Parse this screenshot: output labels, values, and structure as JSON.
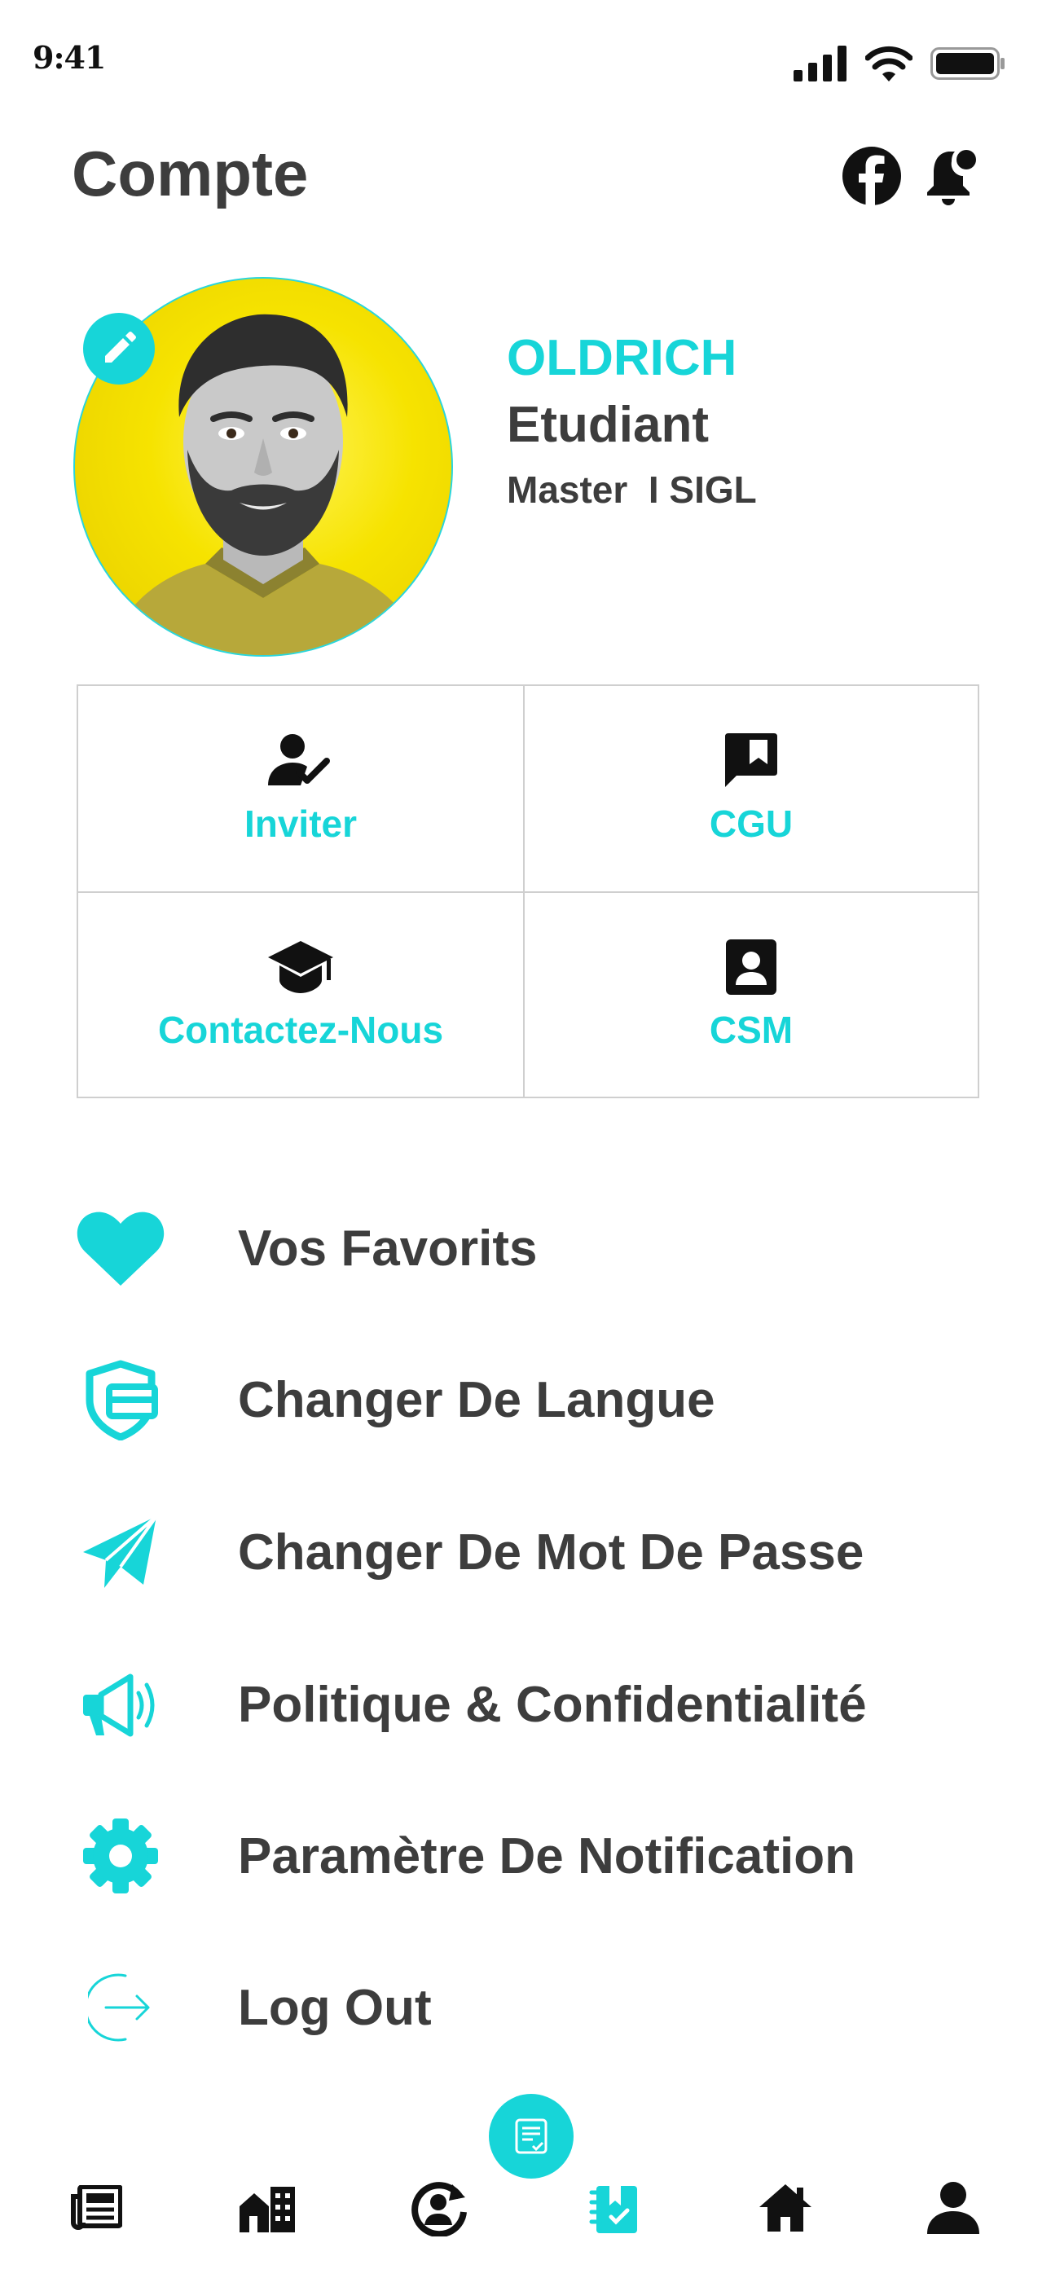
{
  "status_bar": {
    "time": "9:41"
  },
  "header": {
    "title": "Compte"
  },
  "profile": {
    "name": "OLDRICH",
    "role": "Etudiant",
    "level": "Master  I SIGL"
  },
  "grid": [
    {
      "label": "Inviter",
      "icon": "person-check-icon"
    },
    {
      "label": "CGU",
      "icon": "comment-bookmark-icon"
    },
    {
      "label": "Contactez-Nous",
      "icon": "graduation-cap-icon"
    },
    {
      "label": "CSM",
      "icon": "contact-card-icon"
    }
  ],
  "menu": [
    {
      "label": "Vos Favorits",
      "icon": "heart-icon"
    },
    {
      "label": "Changer De Langue",
      "icon": "language-shield-icon"
    },
    {
      "label": "Changer De Mot De Passe",
      "icon": "paper-plane-icon"
    },
    {
      "label": "Politique & Confidentialité",
      "icon": "megaphone-icon"
    },
    {
      "label": "Paramètre De Notification",
      "icon": "gear-icon"
    },
    {
      "label": "Log Out",
      "icon": "logout-icon"
    }
  ],
  "bottom_nav": [
    {
      "icon": "newspaper-icon",
      "active": false
    },
    {
      "icon": "city-icon",
      "active": false
    },
    {
      "icon": "account-sync-icon",
      "active": false
    },
    {
      "icon": "notebook-check-icon",
      "active": true
    },
    {
      "icon": "home-icon",
      "active": false
    },
    {
      "icon": "person-icon",
      "active": false
    }
  ],
  "colors": {
    "accent": "#17d5d8",
    "text": "#3d3d3d",
    "border": "#cfcfcf",
    "icon": "#111111"
  }
}
